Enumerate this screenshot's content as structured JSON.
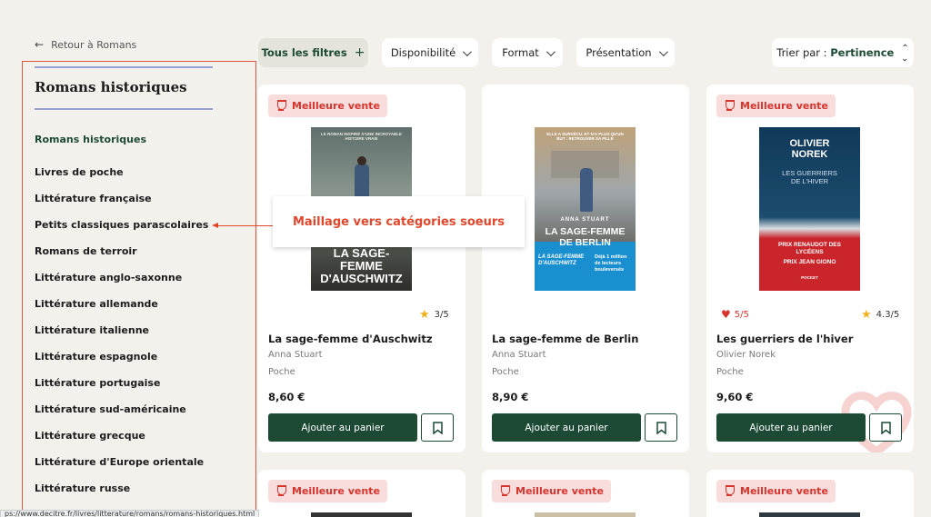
{
  "back_link": {
    "label": "Retour à Romans"
  },
  "sidebar": {
    "title": "Romans historiques",
    "current": "Romans historiques",
    "items": [
      "Livres de poche",
      "Littérature française",
      "Petits classiques parascolaires",
      "Romans de terroir",
      "Littérature anglo-saxonne",
      "Littérature allemande",
      "Littérature italienne",
      "Littérature espagnole",
      "Littérature portugaise",
      "Littérature sud-américaine",
      "Littérature grecque",
      "Littérature d'Europe orientale",
      "Littérature russe"
    ]
  },
  "filters": {
    "all": "Tous les filtres",
    "all_icon": "+",
    "availability": "Disponibilité",
    "format": "Format",
    "presentation": "Présentation",
    "sort_prefix": "Trier par : ",
    "sort_value": "Pertinence"
  },
  "annotation": {
    "text": "Maillage vers catégories soeurs"
  },
  "products": [
    {
      "badge": "Meilleure vente",
      "title": "La sage-femme d'Auschwitz",
      "author": "Anna Stuart",
      "format": "Poche",
      "price": "8,60 €",
      "rating": "3/5",
      "add_label": "Ajouter au panier",
      "cover": {
        "top": "LE ROMAN INSPIRÉ D'UNE INCROYABLE HISTOIRE VRAIE",
        "title": "LA SAGE-FEMME D'AUSCHWITZ"
      }
    },
    {
      "badge": "Meilleure vente",
      "title": "La sage-femme de Berlin",
      "author": "Anna Stuart",
      "format": "Poche",
      "price": "8,90 €",
      "add_label": "Ajouter au panier",
      "cover": {
        "top": "ELLE A SURVÉCU. ET N'A PLUS QU'UN BUT : RETROUVER SA FILLE",
        "author": "ANNA STUART",
        "title": "LA SAGE-FEMME DE BERLIN",
        "band_left": "LA SAGE-FEMME D'AUSCHWITZ",
        "band_right": "Déjà 1 million de lecteurs bouleversés"
      }
    },
    {
      "badge": "Meilleure vente",
      "title": "Les guerriers de l'hiver",
      "author": "Olivier Norek",
      "format": "Poche",
      "price": "9,60 €",
      "rating": "4.3/5",
      "heart_rating": "5/5",
      "add_label": "Ajouter au panier",
      "cover": {
        "author": "OLIVIER NOREK",
        "title": "LES GUERRIERS DE L'HIVER",
        "prize1": "PRIX RENAUDOT DES LYCÉENS",
        "prize2": "PRIX JEAN GIONO",
        "publisher": "POCKET"
      }
    }
  ],
  "second_row_badges": [
    "Meilleure vente",
    "Meilleure vente",
    "Meilleure vente"
  ],
  "status_bar": {
    "url": "ps://www.decitre.fr/livres/litterature/romans/romans-historiques.html"
  },
  "icons": {
    "back": "arrow-left-icon",
    "trophy": "trophy-icon",
    "star": "star-icon",
    "heart": "heart-icon",
    "bookmark": "bookmark-icon",
    "chevron": "chevron-down-icon",
    "sort": "sort-updown-icon"
  },
  "colors": {
    "brand_green": "#1d4a35",
    "accent_red": "#d7342e",
    "annotation": "#e2472c",
    "badge_bg": "#f9dcdc",
    "page_bg": "#f3f1ec"
  }
}
